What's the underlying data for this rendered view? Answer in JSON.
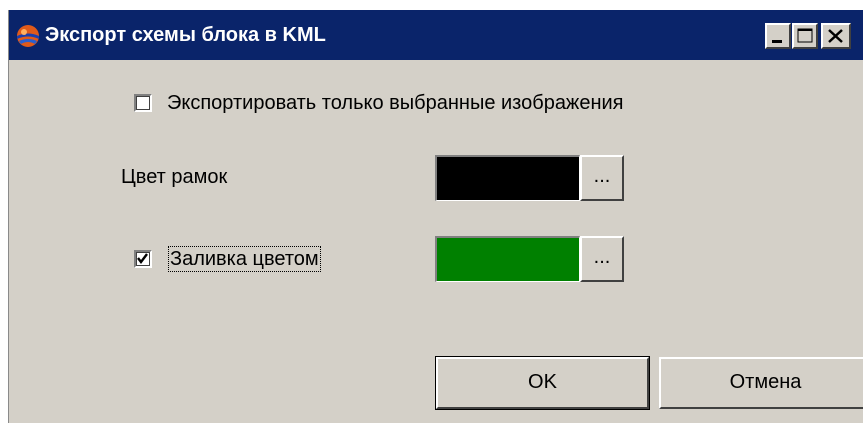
{
  "window": {
    "title": "Экспорт схемы блока в KML",
    "titlebar_color": "#0a246a",
    "background_color": "#d4d0c8"
  },
  "titlebar_buttons": {
    "minimize_icon": "minimize-icon",
    "maximize_icon": "maximize-icon",
    "close_icon": "close-icon"
  },
  "options": {
    "export_selected_only": {
      "label": "Экспортировать только выбранные изображения",
      "checked": false
    },
    "frame_color": {
      "label": "Цвет рамок",
      "color": "#000000",
      "picker_label": "..."
    },
    "fill_color": {
      "label": "Заливка цветом",
      "checked": true,
      "color": "#008000",
      "picker_label": "..."
    }
  },
  "buttons": {
    "ok_label": "OK",
    "cancel_label": "Отмена"
  }
}
